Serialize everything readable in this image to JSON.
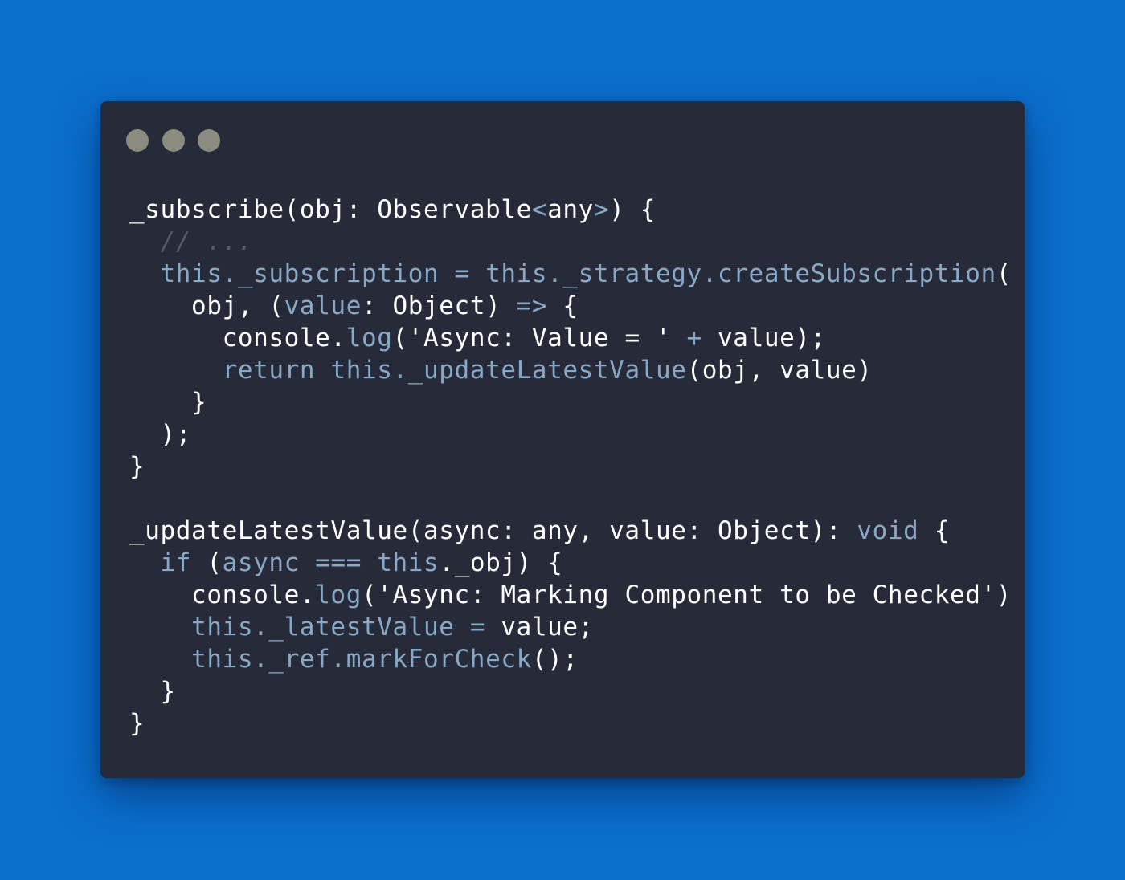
{
  "window": {
    "controls": [
      "close",
      "minimize",
      "maximize"
    ]
  },
  "colors": {
    "background": "#0b6fce",
    "editor": "#272a38",
    "text": "#ffffff",
    "keyword": "#87a9c7",
    "comment": "#535a6d",
    "window_dot": "#8b8b80"
  },
  "code_lines": [
    [
      [
        "_subscribe(obj: Observable",
        "text"
      ],
      [
        "<",
        "keyword"
      ],
      [
        "any",
        "text"
      ],
      [
        ">",
        "keyword"
      ],
      [
        ") {",
        "text"
      ]
    ],
    [
      [
        "  ",
        "text"
      ],
      [
        "// ...",
        "comment"
      ]
    ],
    [
      [
        "  ",
        "text"
      ],
      [
        "this._subscription",
        "keyword"
      ],
      [
        " ",
        "text"
      ],
      [
        "=",
        "keyword"
      ],
      [
        " ",
        "text"
      ],
      [
        "this._strategy.createSubscription",
        "keyword"
      ],
      [
        "(",
        "text"
      ]
    ],
    [
      [
        "    obj, (",
        "text"
      ],
      [
        "value",
        "keyword"
      ],
      [
        ": Object) ",
        "text"
      ],
      [
        "=>",
        "keyword"
      ],
      [
        " {",
        "text"
      ]
    ],
    [
      [
        "      console.",
        "text"
      ],
      [
        "log",
        "keyword"
      ],
      [
        "('Async: Value = ' ",
        "text"
      ],
      [
        "+",
        "keyword"
      ],
      [
        " value);",
        "text"
      ]
    ],
    [
      [
        "      ",
        "text"
      ],
      [
        "return this._updateLatestValue",
        "keyword"
      ],
      [
        "(obj, value)",
        "text"
      ]
    ],
    [
      [
        "    }",
        "text"
      ]
    ],
    [
      [
        "  );",
        "text"
      ]
    ],
    [
      [
        "}",
        "text"
      ]
    ],
    [
      [
        "",
        "text"
      ]
    ],
    [
      [
        "_updateLatestValue(async: any, value: Object): ",
        "text"
      ],
      [
        "void",
        "keyword"
      ],
      [
        " {",
        "text"
      ]
    ],
    [
      [
        "  ",
        "text"
      ],
      [
        "if",
        "keyword"
      ],
      [
        " (",
        "text"
      ],
      [
        "async",
        "keyword"
      ],
      [
        " ",
        "text"
      ],
      [
        "===",
        "keyword"
      ],
      [
        " ",
        "text"
      ],
      [
        "this",
        "keyword"
      ],
      [
        "._obj) {",
        "text"
      ]
    ],
    [
      [
        "    console.",
        "text"
      ],
      [
        "log",
        "keyword"
      ],
      [
        "('Async: Marking Component to be Checked')",
        "text"
      ]
    ],
    [
      [
        "    ",
        "text"
      ],
      [
        "this._latestValue",
        "keyword"
      ],
      [
        " ",
        "text"
      ],
      [
        "=",
        "keyword"
      ],
      [
        " value;",
        "text"
      ]
    ],
    [
      [
        "    ",
        "text"
      ],
      [
        "this._ref.markForCheck",
        "keyword"
      ],
      [
        "();",
        "text"
      ]
    ],
    [
      [
        "  }",
        "text"
      ]
    ],
    [
      [
        "}",
        "text"
      ]
    ]
  ]
}
